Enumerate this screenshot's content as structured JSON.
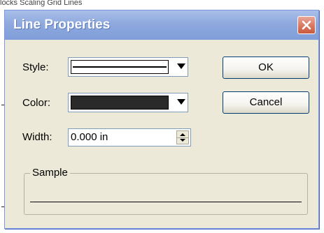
{
  "dialog": {
    "title": "Line Properties"
  },
  "background": {
    "partial_text": "locks    Scaling   Grid Lines"
  },
  "fields": {
    "style_label": "Style:",
    "color_label": "Color:",
    "width_label": "Width:",
    "width_value": "0.000 in",
    "color_value": "#2a2a2a"
  },
  "buttons": {
    "ok": "OK",
    "cancel": "Cancel"
  },
  "sample": {
    "label": "Sample"
  },
  "icons": {
    "close": "close-icon",
    "style_dropdown": "chevron-down-icon",
    "color_dropdown": "chevron-down-icon",
    "spin_up": "spin-up-icon",
    "spin_down": "spin-down-icon"
  }
}
